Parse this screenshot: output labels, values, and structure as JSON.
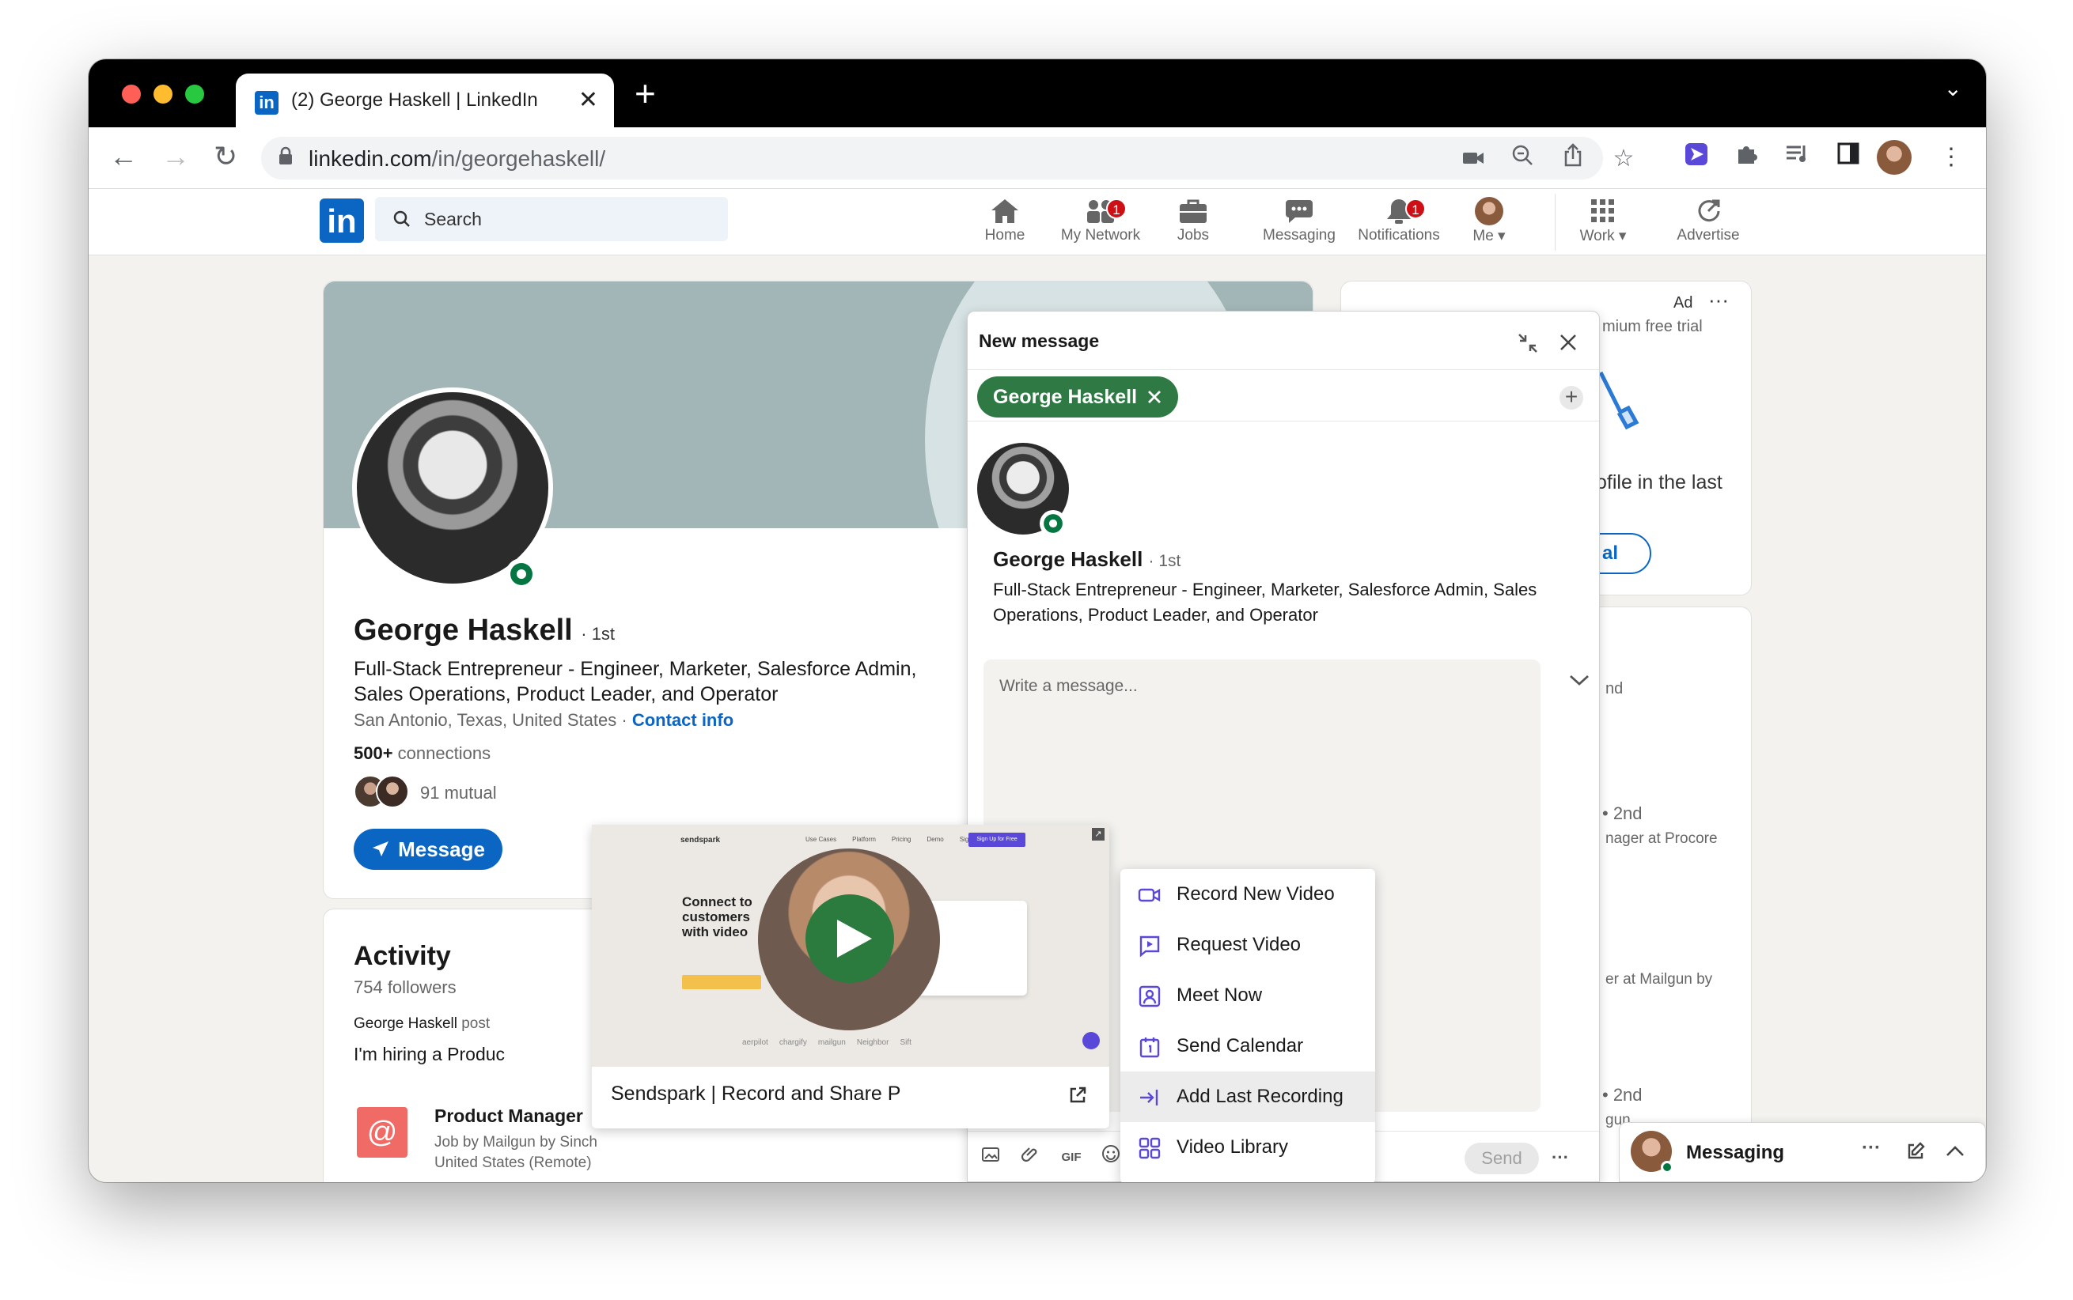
{
  "browser": {
    "tab_title": "(2) George Haskell | LinkedIn",
    "url_host": "linkedin.com",
    "url_path": "/in/georgehaskell/"
  },
  "linkedin_nav": {
    "search_placeholder": "Search",
    "items": [
      {
        "label": "Home",
        "icon": "home-icon",
        "badge": ""
      },
      {
        "label": "My Network",
        "icon": "network-icon",
        "badge": "1"
      },
      {
        "label": "Jobs",
        "icon": "briefcase-icon",
        "badge": ""
      },
      {
        "label": "Messaging",
        "icon": "chat-icon",
        "badge": ""
      },
      {
        "label": "Notifications",
        "icon": "bell-icon",
        "badge": "1"
      },
      {
        "label": "Me",
        "icon": "avatar",
        "badge": ""
      },
      {
        "label": "Work",
        "icon": "grid-icon",
        "badge": ""
      },
      {
        "label": "Advertise",
        "icon": "advertise-icon",
        "badge": ""
      }
    ]
  },
  "profile": {
    "name": "George Haskell",
    "degree": "· 1st",
    "headline": "Full-Stack Entrepreneur - Engineer, Marketer, Salesforce Admin, Sales Operations, Product Leader, and Operator",
    "location": "San Antonio, Texas, United States · ",
    "contact_info": "Contact info",
    "connections_count": "500+",
    "connections_label": " connections",
    "mutual": "91 mutual",
    "message_button": "Message"
  },
  "activity": {
    "title": "Activity",
    "followers": "754 followers",
    "post_author": "George Haskell",
    "post_suffix": " post",
    "post_text": "I'm hiring a Produc",
    "job_title": "Product Manager",
    "job_company": "Job by Mailgun by Sinch",
    "job_location": "United States (Remote)"
  },
  "sidebar": {
    "ad_label": "Ad",
    "ad_text1": "mium free trial",
    "ad_text2": "ofile in the last",
    "ad_button": "al",
    "people_text1": "nd",
    "people_deg1": "• 2nd",
    "people_role1": "nager at Procore",
    "people_role2": "er at Mailgun by",
    "people_deg2": "• 2nd",
    "people_role3": "gun"
  },
  "new_message": {
    "title": "New message",
    "recipient": "George Haskell",
    "name": "George Haskell",
    "degree": "· 1st",
    "headline": "Full-Stack Entrepreneur - Engineer, Marketer, Salesforce Admin, Sales Operations, Product Leader, and Operator",
    "placeholder": "Write a message...",
    "send": "Send",
    "gif": "GIF"
  },
  "video_menu": {
    "items": [
      {
        "label": "Record New Video",
        "icon": "video-camera-icon",
        "highlighted": false
      },
      {
        "label": "Request Video",
        "icon": "request-video-icon",
        "highlighted": false
      },
      {
        "label": "Meet Now",
        "icon": "meet-icon",
        "highlighted": false
      },
      {
        "label": "Send Calendar",
        "icon": "calendar-icon",
        "highlighted": false
      },
      {
        "label": "Add Last Recording",
        "icon": "arrow-in-icon",
        "highlighted": true
      },
      {
        "label": "Video Library",
        "icon": "grid-icon",
        "highlighted": false
      }
    ]
  },
  "video_preview": {
    "caption": "Sendspark | Record and Share P",
    "brand": "sendspark",
    "nav": [
      "Use Cases",
      "Platform",
      "Pricing",
      "Demo",
      "Sign in"
    ],
    "cta": "Sign Up for Free",
    "headline": "Connect to customers with video",
    "logos": [
      "aerpilot",
      "chargify",
      "mailgun",
      "Neighbor",
      "Sift"
    ]
  },
  "messaging_bar": {
    "label": "Messaging"
  },
  "colors": {
    "linkedin_blue": "#0a66c2",
    "recipient_chip": "#2f7a44",
    "sendspark_purple": "#5a48d8",
    "badge_red": "#cc1016"
  }
}
